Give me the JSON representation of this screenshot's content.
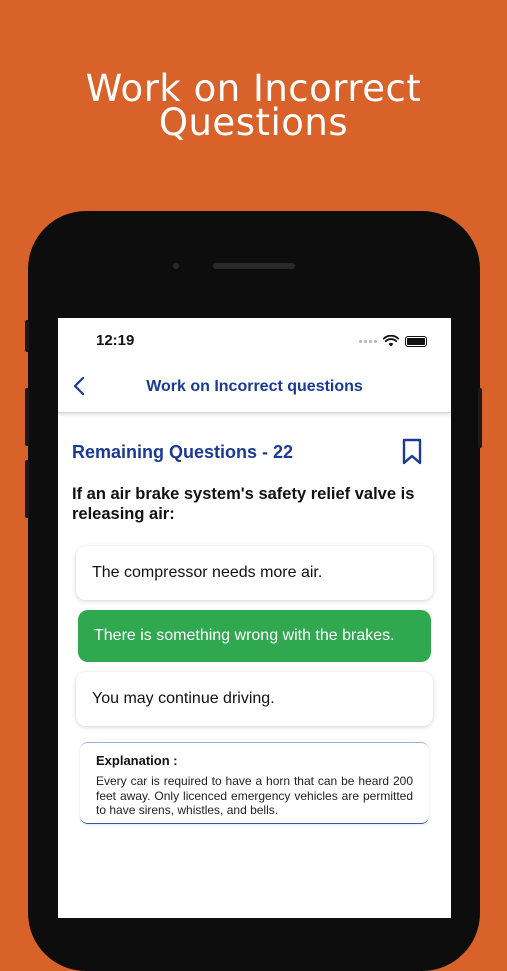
{
  "promo": {
    "title_line1": "Work on Incorrect",
    "title_line2": "Questions"
  },
  "colors": {
    "background": "#d9622a",
    "accent_blue": "#1b3a94",
    "correct_green": "#2fa84f"
  },
  "status_bar": {
    "time": "12:19",
    "icons": [
      "signal-dots-icon",
      "wifi-icon",
      "battery-icon"
    ]
  },
  "navbar": {
    "back_icon": "chevron-left-icon",
    "title": "Work on Incorrect questions"
  },
  "quiz": {
    "remaining_label": "Remaining Questions - 22",
    "bookmark_icon": "bookmark-icon",
    "question": "If an air brake system's safety relief valve is releasing air:",
    "options": [
      {
        "label": "The compressor needs more air.",
        "state": "default"
      },
      {
        "label": "There is something wrong with the brakes.",
        "state": "correct"
      },
      {
        "label": "You may continue driving.",
        "state": "default"
      }
    ],
    "explanation": {
      "label": "Explanation :",
      "text": "Every car is required to have a horn that can be heard 200 feet away. Only licenced emergency vehicles are permitted to have sirens, whistles, and bells."
    }
  }
}
